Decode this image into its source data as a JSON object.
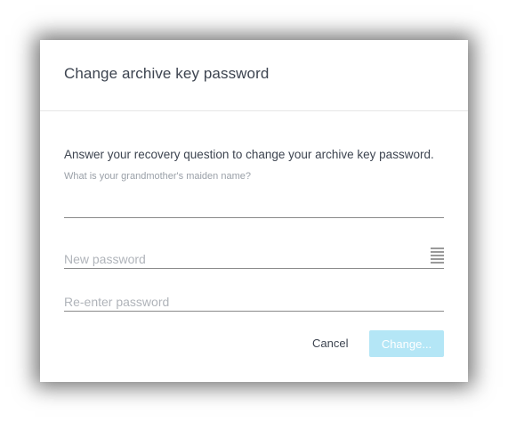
{
  "dialog": {
    "title": "Change archive key password",
    "instruction": "Answer your recovery question to change your archive key password.",
    "question": "What is your grandmother's maiden name?",
    "answer_value": "",
    "new_password_placeholder": "New password",
    "reenter_placeholder": "Re-enter password",
    "cancel_label": "Cancel",
    "change_label": "Change...",
    "change_enabled": false,
    "strength_icon": "password-strength-icon"
  },
  "colors": {
    "primary_disabled": "#b4e6f6",
    "text": "#3d4450",
    "muted": "#9aa0a8"
  }
}
